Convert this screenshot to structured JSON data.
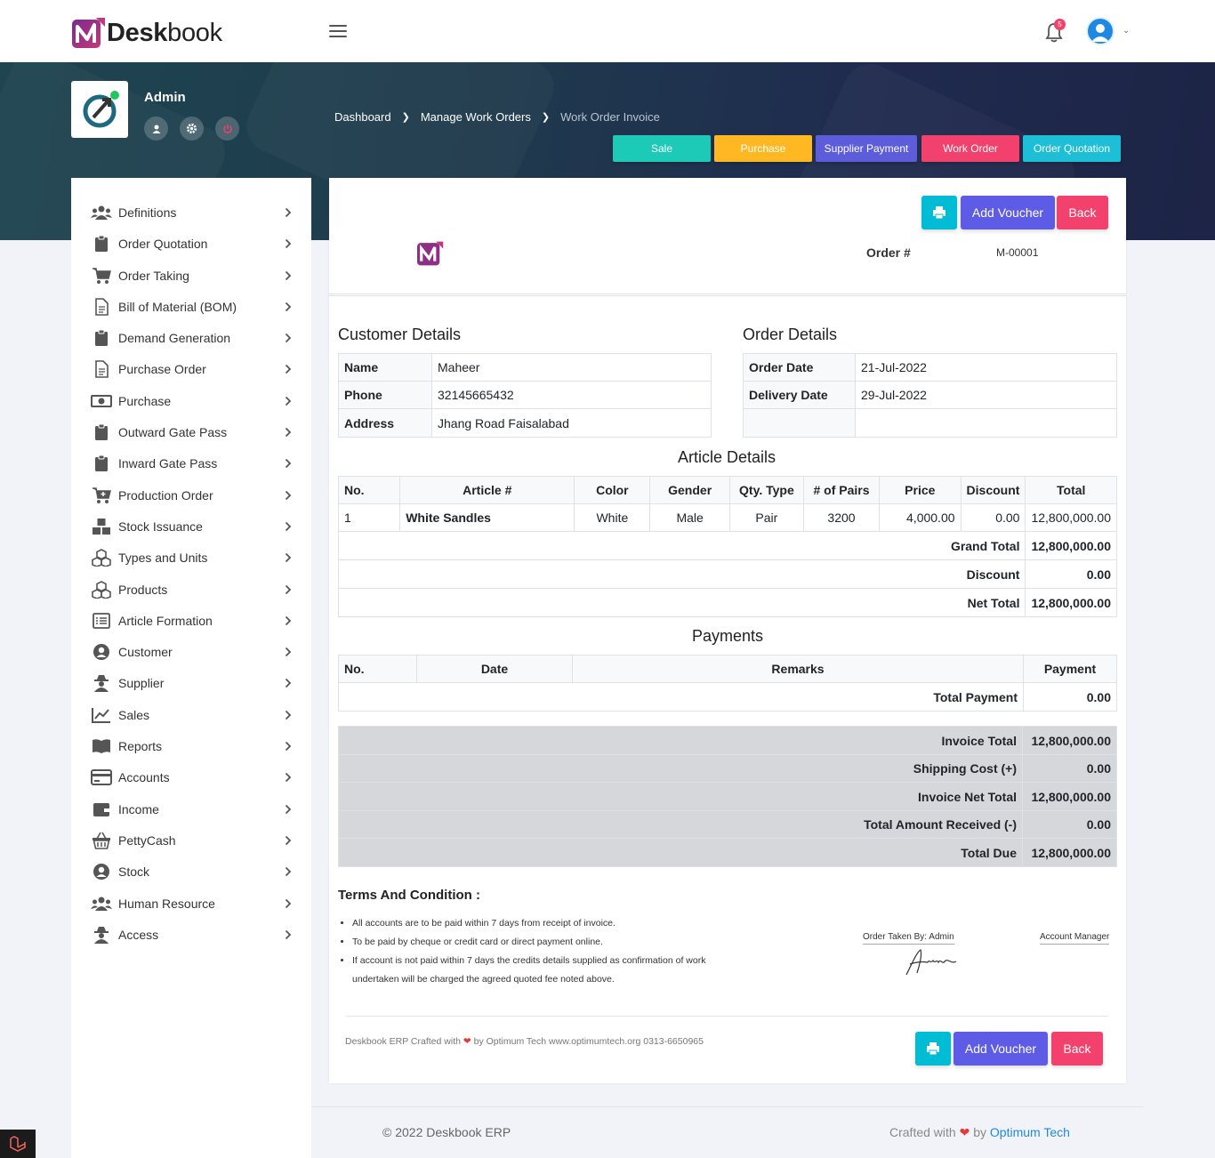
{
  "app": {
    "brand_bold": "Desk",
    "brand_light": "book"
  },
  "header": {
    "notification_count": "5"
  },
  "profile": {
    "name": "Admin"
  },
  "breadcrumb": {
    "items": [
      "Dashboard",
      "Manage Work Orders",
      "Work Order Invoice"
    ]
  },
  "quick_buttons": [
    {
      "label": "Sale",
      "color": "#1dc9b7"
    },
    {
      "label": "Purchase",
      "color": "#ffb822"
    },
    {
      "label": "Supplier Payment",
      "color": "#5d5cdb"
    },
    {
      "label": "Work Order",
      "color": "#f1416c"
    },
    {
      "label": "Order Quotation",
      "color": "#1cbfd6"
    }
  ],
  "sidebar": {
    "items": [
      {
        "label": "Definitions",
        "icon": "users-icon"
      },
      {
        "label": "Order Quotation",
        "icon": "clipboard-icon"
      },
      {
        "label": "Order Taking",
        "icon": "cart-icon"
      },
      {
        "label": "Bill of Material (BOM)",
        "icon": "file-icon"
      },
      {
        "label": "Demand Generation",
        "icon": "clipboard-icon"
      },
      {
        "label": "Purchase Order",
        "icon": "file-icon"
      },
      {
        "label": "Purchase",
        "icon": "money-icon"
      },
      {
        "label": "Outward Gate Pass",
        "icon": "clipboard-icon"
      },
      {
        "label": "Inward Gate Pass",
        "icon": "clipboard-icon"
      },
      {
        "label": "Production Order",
        "icon": "cart-plus-icon"
      },
      {
        "label": "Stock Issuance",
        "icon": "boxes-icon"
      },
      {
        "label": "Types and Units",
        "icon": "cubes-icon"
      },
      {
        "label": "Products",
        "icon": "cubes-icon"
      },
      {
        "label": "Article Formation",
        "icon": "list-icon"
      },
      {
        "label": "Customer",
        "icon": "user-circle-icon"
      },
      {
        "label": "Supplier",
        "icon": "user-secret-icon"
      },
      {
        "label": "Sales",
        "icon": "chart-line-icon"
      },
      {
        "label": "Reports",
        "icon": "book-icon"
      },
      {
        "label": "Accounts",
        "icon": "credit-card-icon"
      },
      {
        "label": "Income",
        "icon": "wallet-icon"
      },
      {
        "label": "PettyCash",
        "icon": "basket-icon"
      },
      {
        "label": "Stock",
        "icon": "user-circle-icon"
      },
      {
        "label": "Human Resource",
        "icon": "users-icon"
      },
      {
        "label": "Access",
        "icon": "user-secret-icon"
      }
    ]
  },
  "actions": {
    "add_voucher": "Add Voucher",
    "back": "Back"
  },
  "invoice": {
    "order_label": "Order #",
    "order_no": "M-00001",
    "customer_title": "Customer Details",
    "order_title": "Order Details",
    "customer": {
      "name_label": "Name",
      "name": "Maheer",
      "phone_label": "Phone",
      "phone": "32145665432",
      "address_label": "Address",
      "address": "Jhang Road Faisalabad"
    },
    "order": {
      "date_label": "Order Date",
      "date": "21-Jul-2022",
      "delivery_label": "Delivery Date",
      "delivery": "29-Jul-2022"
    },
    "article_title": "Article Details",
    "article_headers": [
      "No.",
      "Article #",
      "Color",
      "Gender",
      "Qty. Type",
      "# of Pairs",
      "Price",
      "Discount",
      "Total"
    ],
    "articles": [
      [
        "1",
        "White Sandles",
        "White",
        "Male",
        "Pair",
        "3200",
        "4,000.00",
        "0.00",
        "12,800,000.00"
      ]
    ],
    "grand_total_label": "Grand Total",
    "grand_total": "12,800,000.00",
    "discount_label": "Discount",
    "discount": "0.00",
    "net_total_label": "Net Total",
    "net_total": "12,800,000.00",
    "payments_title": "Payments",
    "payment_headers": [
      "No.",
      "Date",
      "Remarks",
      "Payment"
    ],
    "total_payment_label": "Total Payment",
    "total_payment": "0.00",
    "summary": [
      {
        "label": "Invoice Total",
        "value": "12,800,000.00"
      },
      {
        "label": "Shipping Cost (+)",
        "value": "0.00"
      },
      {
        "label": "Invoice Net Total",
        "value": "12,800,000.00"
      },
      {
        "label": "Total Amount Received (-)",
        "value": "0.00"
      },
      {
        "label": "Total Due",
        "value": "12,800,000.00"
      }
    ],
    "terms_title": "Terms And Condition :",
    "terms": [
      "All accounts are to be paid within 7 days from receipt of invoice.",
      "To be paid by cheque or credit card or direct payment online.",
      "If account is not paid within 7 days the credits details supplied as confirmation of work undertaken will be charged the agreed quoted fee noted above."
    ],
    "order_taken_by": "Order Taken By: Admin",
    "signature": "Admin",
    "account_manager": "Account Manager",
    "credit_pre": "Deskbook ERP Crafted with",
    "credit_post": "by Optimum Tech www.optimumtech.org 0313-6650965"
  },
  "footer": {
    "copyright": "© 2022 Deskbook ERP",
    "crafted_pre": "Crafted with",
    "crafted_by": "by",
    "company": "Optimum Tech"
  }
}
